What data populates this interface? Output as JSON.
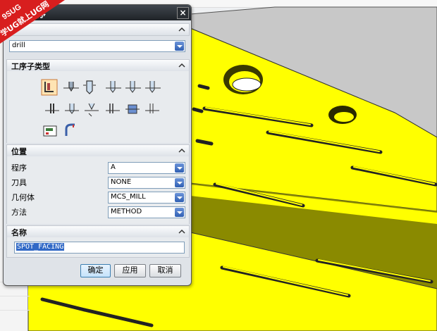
{
  "dialog": {
    "title": "序",
    "close_glyph": "×",
    "type_value": "drill",
    "sections": {
      "subtype": "工序子类型",
      "location": "位置",
      "name": "名称"
    },
    "location_rows": [
      {
        "label": "程序",
        "value": "A"
      },
      {
        "label": "刀具",
        "value": "NONE"
      },
      {
        "label": "几何体",
        "value": "MCS_MILL"
      },
      {
        "label": "方法",
        "value": "METHOD"
      }
    ],
    "name_value": "SPOT_FACING",
    "buttons": {
      "ok": "确定",
      "apply": "应用",
      "cancel": "取消"
    },
    "subtype_icons": [
      "spot-facing-icon",
      "spot-drilling-icon",
      "drilling-icon",
      "peck-drilling-icon",
      "breakchip-drilling-icon",
      "boring-icon",
      "reaming-icon",
      "counterboring-icon",
      "countersinking-icon",
      "tapping-icon",
      "hole-milling-icon",
      "thread-milling-icon",
      "mill-control-icon",
      "mill-user-icon"
    ]
  },
  "watermark": {
    "line1": "9SUG",
    "line2": "学UG就上UG网"
  },
  "colors": {
    "part_yellow": "#ffff00",
    "edge_dark": "#3a3a00",
    "titlebar": "#2a2e33",
    "accent_blue": "#2f5fb3"
  }
}
